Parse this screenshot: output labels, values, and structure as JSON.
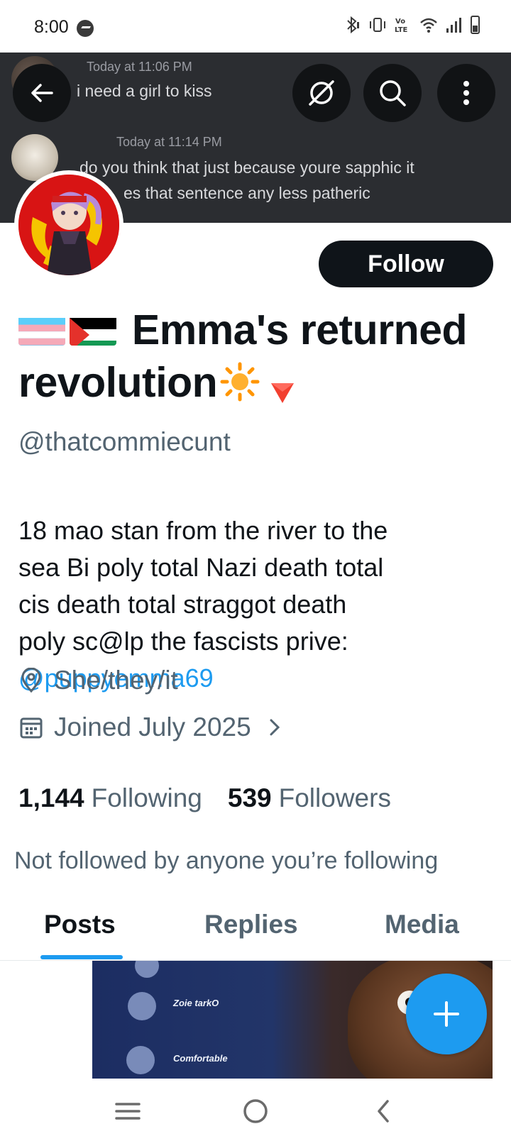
{
  "status_bar": {
    "time": "8:00",
    "icons": [
      "messenger-icon",
      "bluetooth-icon",
      "vibrate-icon",
      "volte-icon",
      "wifi-icon",
      "signal-icon",
      "battery-icon"
    ]
  },
  "banner": {
    "messages": [
      {
        "time": "Today at 11:06 PM",
        "text": "i need a girl to kiss"
      },
      {
        "time": "Today at 11:14 PM",
        "line1": "do you think that just because youre sapphic it",
        "line2": "es that sentence any less patheric"
      }
    ]
  },
  "profile": {
    "follow_label": "Follow",
    "name_text_1": "Emma's returned",
    "name_text_2": "revolution",
    "handle": "@thatcommiecunt",
    "bio": "18 mao stan from the river to the\nsea   Bi poly total Nazi death total\ncis death total straggot death\npoly sc@lp the fascists prive:",
    "bio_link": "@puppyemma69",
    "pronouns": "She/they/it",
    "joined": "Joined July 2025",
    "following_count": "1,144",
    "following_label": "Following",
    "followers_count": "539",
    "followers_label": "Followers",
    "not_followed": "Not followed by anyone you’re following"
  },
  "tabs": [
    {
      "label": "Posts",
      "active": true
    },
    {
      "label": "Replies",
      "active": false
    },
    {
      "label": "Media",
      "active": false
    }
  ],
  "media_preview": {
    "label_1": "Zoie tarkO",
    "label_2": "Comfortable"
  },
  "colors": {
    "accent": "#1d9bf0",
    "text_primary": "#0f1419",
    "text_secondary": "#536471",
    "banner": "#2b2d31",
    "follow_button": "#0f1419"
  }
}
